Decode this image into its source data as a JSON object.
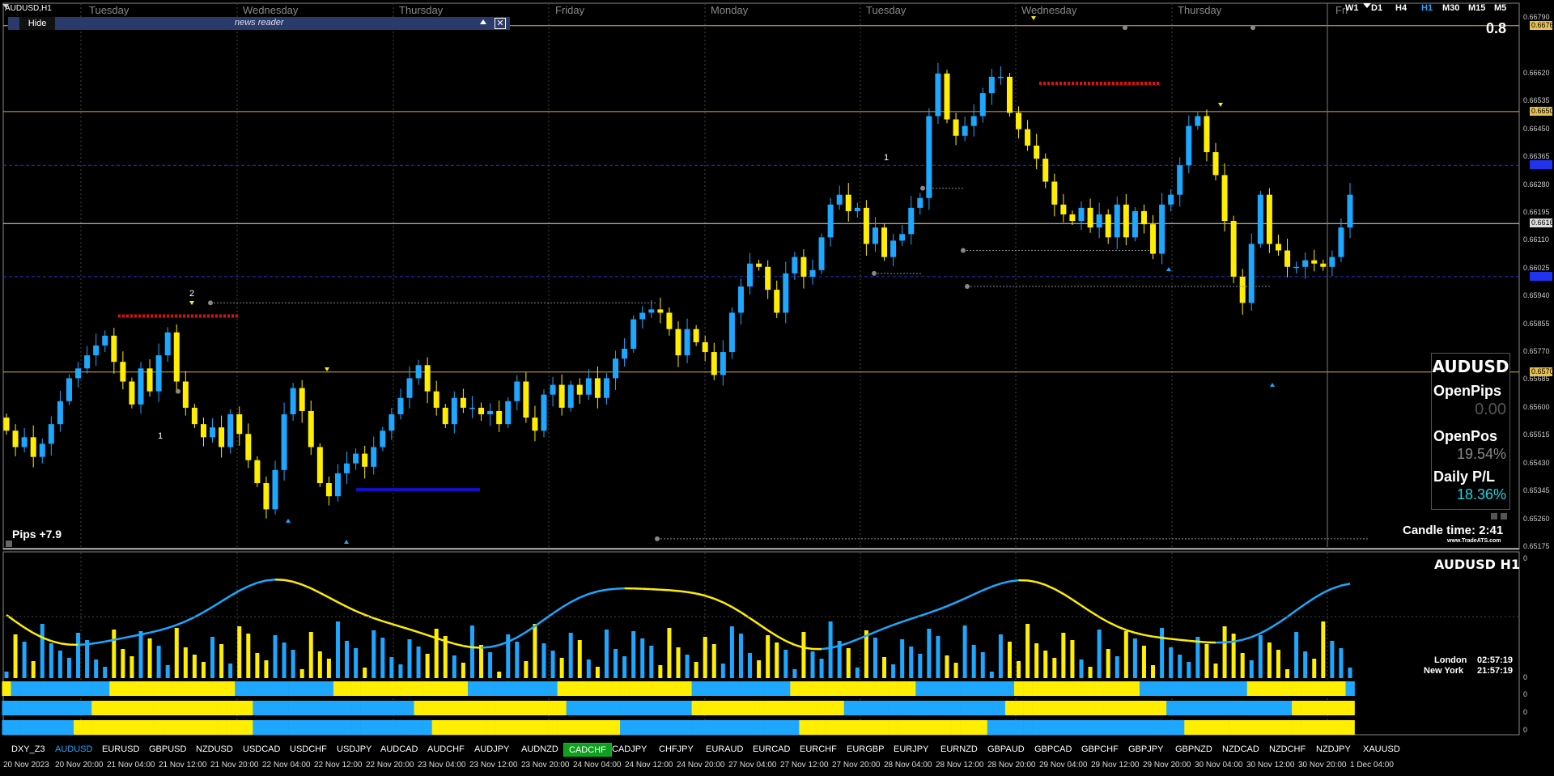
{
  "window_title": "AUDUSD,H1",
  "news_reader": {
    "hide_label": "Hide",
    "title": "news reader"
  },
  "day_labels": [
    "Tuesday",
    "Wednesday",
    "Thursday",
    "Friday",
    "Monday",
    "Tuesday",
    "Wednesday",
    "Thursday",
    "Fri"
  ],
  "timeframes": [
    "W1",
    "D1",
    "H4",
    "H1",
    "M30",
    "M15",
    "M5"
  ],
  "active_timeframe": "H1",
  "level_value": "0.8",
  "price_scale": [
    "0.66790",
    "0.66766",
    "0.66620",
    "0.66535",
    "0.66504",
    "0.66450",
    "0.66365",
    "0.66280",
    "0.66195",
    "0.66162",
    "0.66110",
    "0.66025",
    "0.65940",
    "0.65855",
    "0.65770",
    "0.65709",
    "0.65685",
    "0.65600",
    "0.65515",
    "0.65430",
    "0.65345",
    "0.65260",
    "0.65175"
  ],
  "price_tags": {
    "top_line": "0.66766",
    "upper_line": "0.66504",
    "bid_line": "0.66162",
    "lower_line": "0.65709"
  },
  "pips_text": "Pips +7.9",
  "panel": {
    "symbol": "AUDUSD",
    "open_pips_label": "OpenPips",
    "open_pips_value": "0.00",
    "open_pos_label": "OpenPos",
    "open_pos_value": "19.54%",
    "daily_pl_label": "Daily P/L",
    "daily_pl_value": "18.36%"
  },
  "candle_time": "Candle time:  2:41",
  "brand": "www.TradeATS.com",
  "indicator_title": "AUDUSD  H1",
  "indicator_scale": [
    "0",
    "0",
    "0",
    "0",
    "0"
  ],
  "clocks": [
    {
      "city": "London",
      "time": "02:57:19"
    },
    {
      "city": "New York",
      "time": "21:57:19"
    }
  ],
  "symbols": [
    "DXY_Z3",
    "AUDUSD",
    "EURUSD",
    "GBPUSD",
    "NZDUSD",
    "USDCAD",
    "USDCHF",
    "USDJPY",
    "AUDCAD",
    "AUDCHF",
    "AUDJPY",
    "AUDNZD",
    "CADCHF",
    "CADJPY",
    "CHFJPY",
    "EURAUD",
    "EURCAD",
    "EURCHF",
    "EURGBP",
    "EURJPY",
    "EURNZD",
    "GBPAUD",
    "GBPCAD",
    "GBPCHF",
    "GBPJPY",
    "GBPNZD",
    "NZDCAD",
    "NZDCHF",
    "NZDJPY",
    "XAUUSD"
  ],
  "current_symbol": "AUDUSD",
  "highlighted_symbol": "CADCHF",
  "time_axis": [
    "20 Nov 2023",
    "20 Nov 20:00",
    "21 Nov 04:00",
    "21 Nov 12:00",
    "21 Nov 20:00",
    "22 Nov 04:00",
    "22 Nov 12:00",
    "22 Nov 20:00",
    "23 Nov 04:00",
    "23 Nov 12:00",
    "23 Nov 20:00",
    "24 Nov 04:00",
    "24 Nov 12:00",
    "24 Nov 20:00",
    "27 Nov 04:00",
    "27 Nov 12:00",
    "27 Nov 20:00",
    "28 Nov 04:00",
    "28 Nov 12:00",
    "28 Nov 20:00",
    "29 Nov 04:00",
    "29 Nov 12:00",
    "29 Nov 20:00",
    "30 Nov 04:00",
    "30 Nov 12:00",
    "30 Nov 20:00",
    "1 Dec 04:00"
  ],
  "marks": [
    "2",
    "1",
    "1"
  ],
  "colors": {
    "bull": "#1ea7ff",
    "bear": "#ffee00",
    "level": "#e0b030",
    "grid": "#444444",
    "background": "#000000"
  },
  "chart_data": {
    "type": "candlestick",
    "ylim": [
      0.65175,
      0.6679
    ],
    "close": [
      0.6553,
      0.6548,
      0.6551,
      0.6545,
      0.6549,
      0.6555,
      0.6562,
      0.6569,
      0.6572,
      0.6576,
      0.6579,
      0.6582,
      0.6574,
      0.6568,
      0.6561,
      0.6572,
      0.6565,
      0.6576,
      0.6583,
      0.6568,
      0.656,
      0.6555,
      0.6551,
      0.6554,
      0.6548,
      0.6558,
      0.6552,
      0.6544,
      0.6537,
      0.6529,
      0.6541,
      0.6558,
      0.6566,
      0.6559,
      0.6548,
      0.6537,
      0.6533,
      0.654,
      0.6543,
      0.6546,
      0.6542,
      0.6548,
      0.6553,
      0.6558,
      0.6563,
      0.6569,
      0.6573,
      0.6565,
      0.656,
      0.6555,
      0.6563,
      0.656,
      0.656,
      0.6558,
      0.6559,
      0.6555,
      0.6562,
      0.6568,
      0.6557,
      0.6553,
      0.6564,
      0.6567,
      0.656,
      0.6567,
      0.6564,
      0.6569,
      0.6563,
      0.6569,
      0.6575,
      0.6578,
      0.6587,
      0.6589,
      0.659,
      0.6589,
      0.6584,
      0.6576,
      0.6584,
      0.658,
      0.6577,
      0.657,
      0.6577,
      0.6589,
      0.6597,
      0.6604,
      0.6603,
      0.6596,
      0.6589,
      0.6601,
      0.6606,
      0.66,
      0.6602,
      0.6612,
      0.6622,
      0.6625,
      0.662,
      0.6621,
      0.661,
      0.6615,
      0.6606,
      0.6611,
      0.6613,
      0.6621,
      0.6624,
      0.6649,
      0.6662,
      0.6648,
      0.6643,
      0.6646,
      0.6649,
      0.6656,
      0.6661,
      0.6661,
      0.665,
      0.6645,
      0.664,
      0.6636,
      0.6629,
      0.6622,
      0.6619,
      0.6617,
      0.6621,
      0.6615,
      0.6619,
      0.6612,
      0.6622,
      0.6612,
      0.662,
      0.6616,
      0.6607,
      0.6622,
      0.6625,
      0.6634,
      0.6646,
      0.6649,
      0.6638,
      0.6631,
      0.6617,
      0.66,
      0.6592,
      0.661,
      0.6625,
      0.661,
      0.6608,
      0.6603,
      0.6603,
      0.6605,
      0.6604,
      0.6603,
      0.6606,
      0.6615,
      0.6625
    ]
  }
}
